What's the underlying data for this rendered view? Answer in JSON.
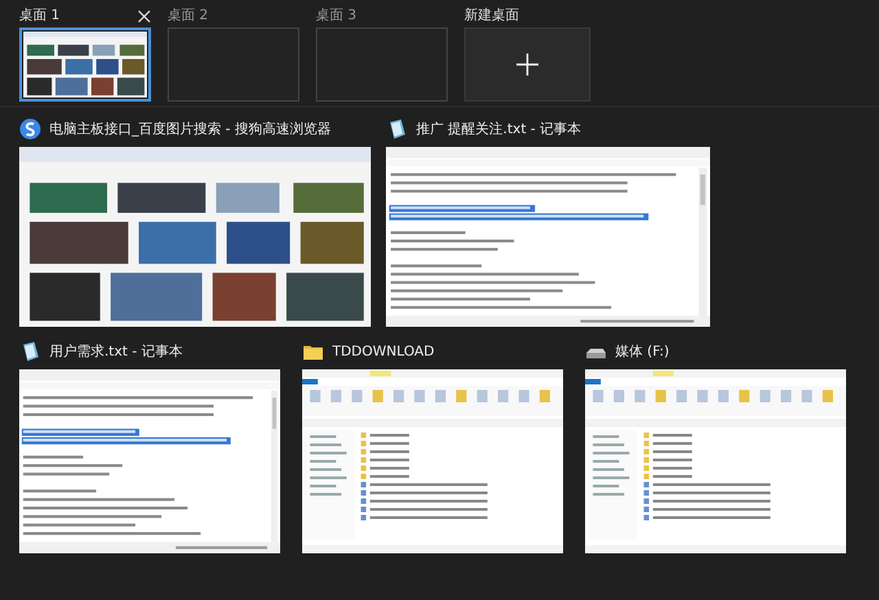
{
  "desktops": [
    {
      "label": "桌面 1",
      "selected": true,
      "close_button": true
    },
    {
      "label": "桌面 2",
      "selected": false,
      "close_button": false
    },
    {
      "label": "桌面 3",
      "selected": false,
      "close_button": false
    }
  ],
  "new_desktop": {
    "label": "新建桌面"
  },
  "window_rows": [
    [
      {
        "title": "电脑主板接口_百度图片搜索 - 搜狗高速浏览器",
        "kind": "browser"
      },
      {
        "title": "推广 提醒关注.txt - 记事本",
        "kind": "notepad"
      }
    ],
    [
      {
        "title": "用户需求.txt - 记事本",
        "kind": "notepad"
      },
      {
        "title": "TDDOWNLOAD",
        "kind": "folder"
      },
      {
        "title": "媒体 (F:)",
        "kind": "drive"
      }
    ]
  ]
}
